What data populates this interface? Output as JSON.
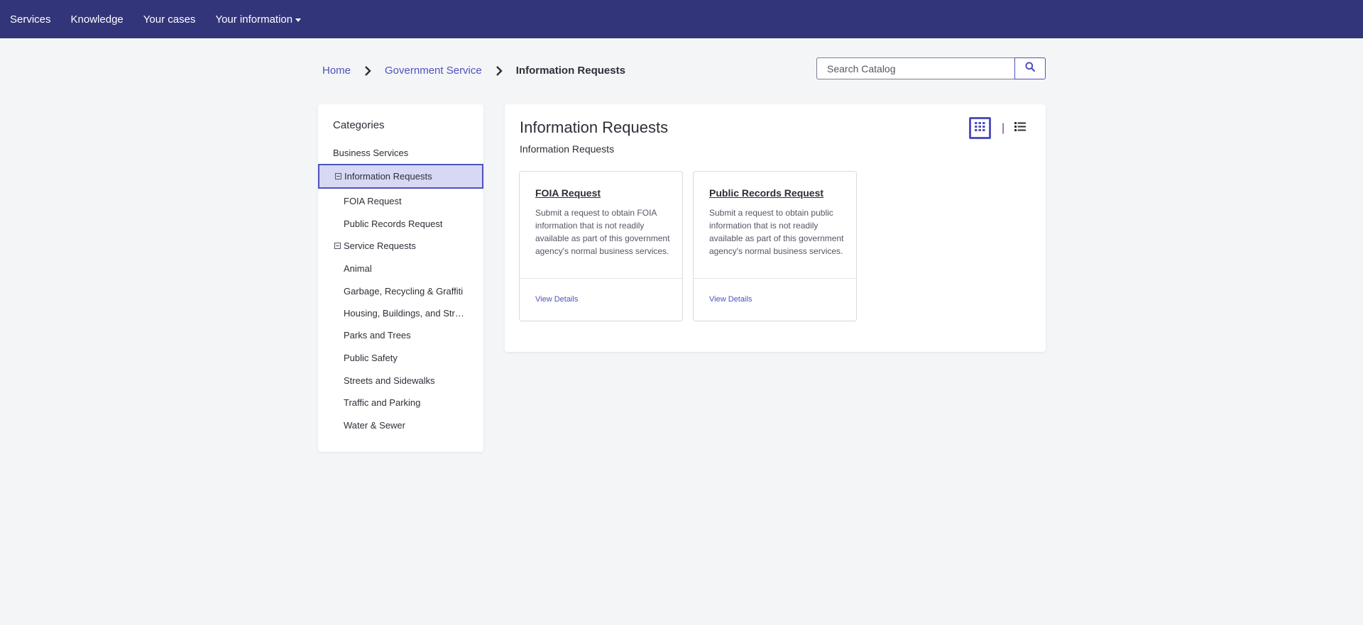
{
  "topnav": {
    "items": [
      {
        "label": "Services"
      },
      {
        "label": "Knowledge"
      },
      {
        "label": "Your cases"
      },
      {
        "label": "Your information",
        "has_dropdown": true
      }
    ],
    "background": "#33357a"
  },
  "breadcrumb": {
    "items": [
      {
        "label": "Home"
      },
      {
        "label": "Government Service"
      },
      {
        "label": "Information Requests"
      }
    ]
  },
  "search": {
    "placeholder": "Search Catalog",
    "value": ""
  },
  "sidebar": {
    "title": "Categories",
    "items": [
      {
        "label": "Business Services",
        "level": 0
      },
      {
        "label": "Information Requests",
        "level": 0,
        "expanded": true,
        "active": true
      },
      {
        "label": "FOIA Request",
        "level": 1
      },
      {
        "label": "Public Records Request",
        "level": 1
      },
      {
        "label": "Service Requests",
        "level": 0,
        "expanded": true
      },
      {
        "label": "Animal",
        "level": 1
      },
      {
        "label": "Garbage, Recycling & Graffiti",
        "level": 1
      },
      {
        "label": "Housing, Buildings, and Struct...",
        "level": 1
      },
      {
        "label": "Parks and Trees",
        "level": 1
      },
      {
        "label": "Public Safety",
        "level": 1
      },
      {
        "label": "Streets and Sidewalks",
        "level": 1
      },
      {
        "label": "Traffic and Parking",
        "level": 1
      },
      {
        "label": "Water & Sewer",
        "level": 1
      }
    ]
  },
  "main": {
    "title": "Information Requests",
    "subtitle": "Information Requests",
    "view_toggle": {
      "active": "grid",
      "separator": "|"
    },
    "cards": [
      {
        "title": "FOIA Request",
        "description": "Submit a request to obtain FOIA information that is not readily available as part of this government agency's normal business services.",
        "link": "View Details"
      },
      {
        "title": "Public Records Request",
        "description": "Submit a request to obtain public information that is not readily available as part of this government agency's normal business services.",
        "link": "View Details"
      }
    ]
  },
  "colors": {
    "accent": "#4f52bd",
    "active_bg": "#d7d8f3",
    "page_bg": "#f4f5f7"
  }
}
